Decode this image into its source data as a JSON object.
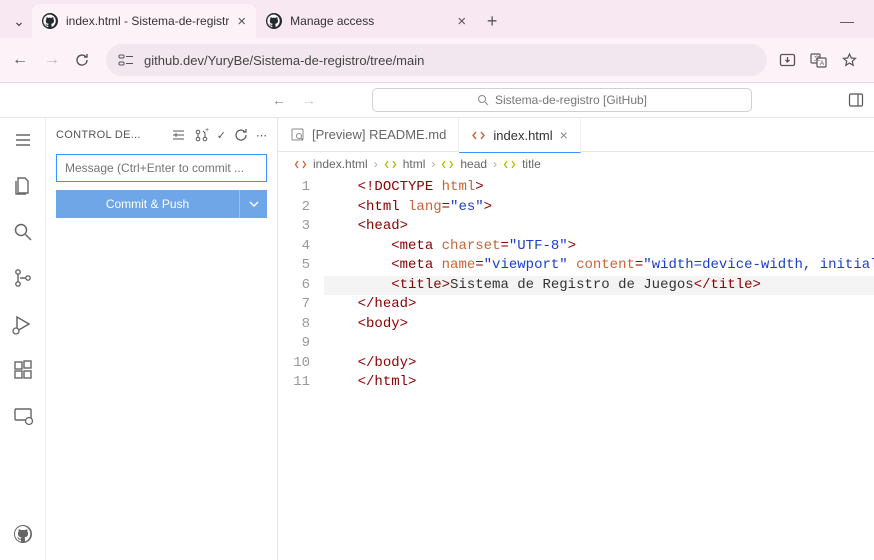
{
  "browser": {
    "tabs": [
      {
        "title": "index.html - Sistema-de-registr",
        "active": true
      },
      {
        "title": "Manage access",
        "active": false
      }
    ],
    "url": "github.dev/YuryBe/Sistema-de-registro/tree/main"
  },
  "vscode": {
    "search_text": "Sistema-de-registro [GitHub]"
  },
  "sidebar": {
    "header": "CONTROL DE...",
    "commit_placeholder": "Message (Ctrl+Enter to commit ...",
    "commit_button": "Commit & Push"
  },
  "editor": {
    "tabs": [
      {
        "label": "[Preview] README.md",
        "active": false,
        "icon": "preview"
      },
      {
        "label": "index.html",
        "active": true,
        "icon": "code"
      }
    ],
    "breadcrumb": [
      "index.html",
      "html",
      "head",
      "title"
    ],
    "active_line": 6,
    "lines": [
      {
        "n": 1,
        "indent": 0,
        "tokens": [
          [
            "punc",
            "<!"
          ],
          [
            "tag",
            "DOCTYPE"
          ],
          [
            "text",
            " "
          ],
          [
            "attr",
            "html"
          ],
          [
            "punc",
            ">"
          ]
        ]
      },
      {
        "n": 2,
        "indent": 0,
        "tokens": [
          [
            "punc",
            "<"
          ],
          [
            "tag",
            "html"
          ],
          [
            "text",
            " "
          ],
          [
            "attr",
            "lang"
          ],
          [
            "punc",
            "="
          ],
          [
            "str",
            "\"es\""
          ],
          [
            "punc",
            ">"
          ]
        ]
      },
      {
        "n": 3,
        "indent": 0,
        "tokens": [
          [
            "punc",
            "<"
          ],
          [
            "tag",
            "head"
          ],
          [
            "punc",
            ">"
          ]
        ]
      },
      {
        "n": 4,
        "indent": 1,
        "tokens": [
          [
            "punc",
            "<"
          ],
          [
            "tag",
            "meta"
          ],
          [
            "text",
            " "
          ],
          [
            "attr",
            "charset"
          ],
          [
            "punc",
            "="
          ],
          [
            "str",
            "\"UTF-8\""
          ],
          [
            "punc",
            ">"
          ]
        ]
      },
      {
        "n": 5,
        "indent": 1,
        "tokens": [
          [
            "punc",
            "<"
          ],
          [
            "tag",
            "meta"
          ],
          [
            "text",
            " "
          ],
          [
            "attr",
            "name"
          ],
          [
            "punc",
            "="
          ],
          [
            "str",
            "\"viewport\""
          ],
          [
            "text",
            " "
          ],
          [
            "attr",
            "content"
          ],
          [
            "punc",
            "="
          ],
          [
            "str",
            "\"width=device-width, initial-scal"
          ]
        ]
      },
      {
        "n": 6,
        "indent": 1,
        "tokens": [
          [
            "punc",
            "<"
          ],
          [
            "tag",
            "title"
          ],
          [
            "punc",
            ">"
          ],
          [
            "text",
            "Sistema de Registro de Juegos"
          ],
          [
            "punc",
            "</"
          ],
          [
            "tag",
            "title"
          ],
          [
            "punc",
            ">"
          ]
        ]
      },
      {
        "n": 7,
        "indent": 0,
        "tokens": [
          [
            "punc",
            "</"
          ],
          [
            "tag",
            "head"
          ],
          [
            "punc",
            ">"
          ]
        ]
      },
      {
        "n": 8,
        "indent": 0,
        "tokens": [
          [
            "punc",
            "<"
          ],
          [
            "tag",
            "body"
          ],
          [
            "punc",
            ">"
          ]
        ]
      },
      {
        "n": 9,
        "indent": 0,
        "tokens": []
      },
      {
        "n": 10,
        "indent": 0,
        "tokens": [
          [
            "punc",
            "</"
          ],
          [
            "tag",
            "body"
          ],
          [
            "punc",
            ">"
          ]
        ]
      },
      {
        "n": 11,
        "indent": 0,
        "tokens": [
          [
            "punc",
            "</"
          ],
          [
            "tag",
            "html"
          ],
          [
            "punc",
            ">"
          ]
        ]
      }
    ]
  }
}
